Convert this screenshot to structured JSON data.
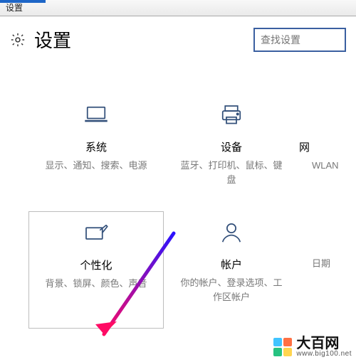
{
  "window": {
    "title": "设置"
  },
  "header": {
    "page_title": "设置",
    "search_placeholder": "查找设置"
  },
  "tiles": {
    "system": {
      "title": "系统",
      "desc": "显示、通知、搜索、电源"
    },
    "devices": {
      "title": "设备",
      "desc": "蓝牙、打印机、鼠标、键盘"
    },
    "network": {
      "title": "网",
      "desc": "WLAN"
    },
    "personalize": {
      "title": "个性化",
      "desc": "背景、锁屏、颜色、声音"
    },
    "accounts": {
      "title": "帐户",
      "desc": "你的帐户、登录选项、工作区帐户"
    },
    "time": {
      "title": "",
      "desc": "日期"
    }
  },
  "watermark": {
    "brand": "大百网",
    "url": "www.big100.net",
    "colors": {
      "tl": "#40c4ff",
      "tr": "#ff7043",
      "bl": "#26c281",
      "br": "#ffd54f"
    }
  }
}
